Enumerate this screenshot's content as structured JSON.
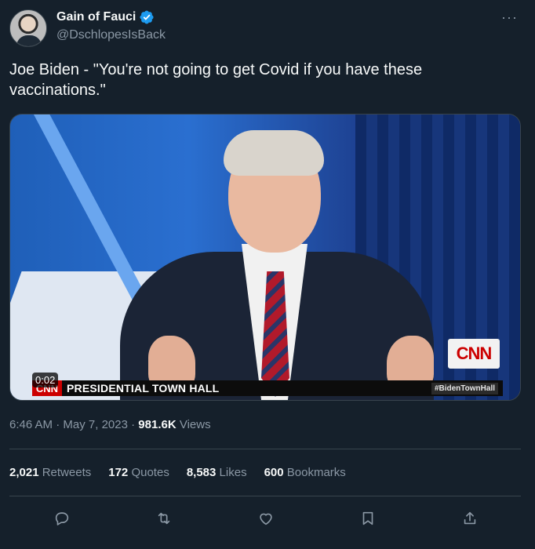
{
  "author": {
    "display_name": "Gain of Fauci",
    "handle": "@DschlopesIsBack",
    "verified": true
  },
  "tweet": {
    "text": "Joe Biden - \"You're not going to get Covid if you have these vaccinations.\""
  },
  "media": {
    "timer": "0:02",
    "lower_third_logo": "CNN",
    "lower_third_title": "PRESIDENTIAL TOWN HALL",
    "hashtag": "#BidenTownHall",
    "corner_logo": "CNN"
  },
  "meta": {
    "time": "6:46 AM",
    "separator": "·",
    "date": "May 7, 2023",
    "views_count": "981.6K",
    "views_label": "Views"
  },
  "stats": [
    {
      "count": "2,021",
      "label": "Retweets"
    },
    {
      "count": "172",
      "label": "Quotes"
    },
    {
      "count": "8,583",
      "label": "Likes"
    },
    {
      "count": "600",
      "label": "Bookmarks"
    }
  ],
  "more_icon": "···",
  "colors": {
    "background": "#15202b",
    "text": "#f7f9f9",
    "muted": "#8b98a5",
    "divider": "#38444d",
    "verified": "#1d9bf0"
  },
  "icons": [
    "reply-icon",
    "retweet-icon",
    "like-icon",
    "bookmark-icon",
    "share-icon"
  ]
}
